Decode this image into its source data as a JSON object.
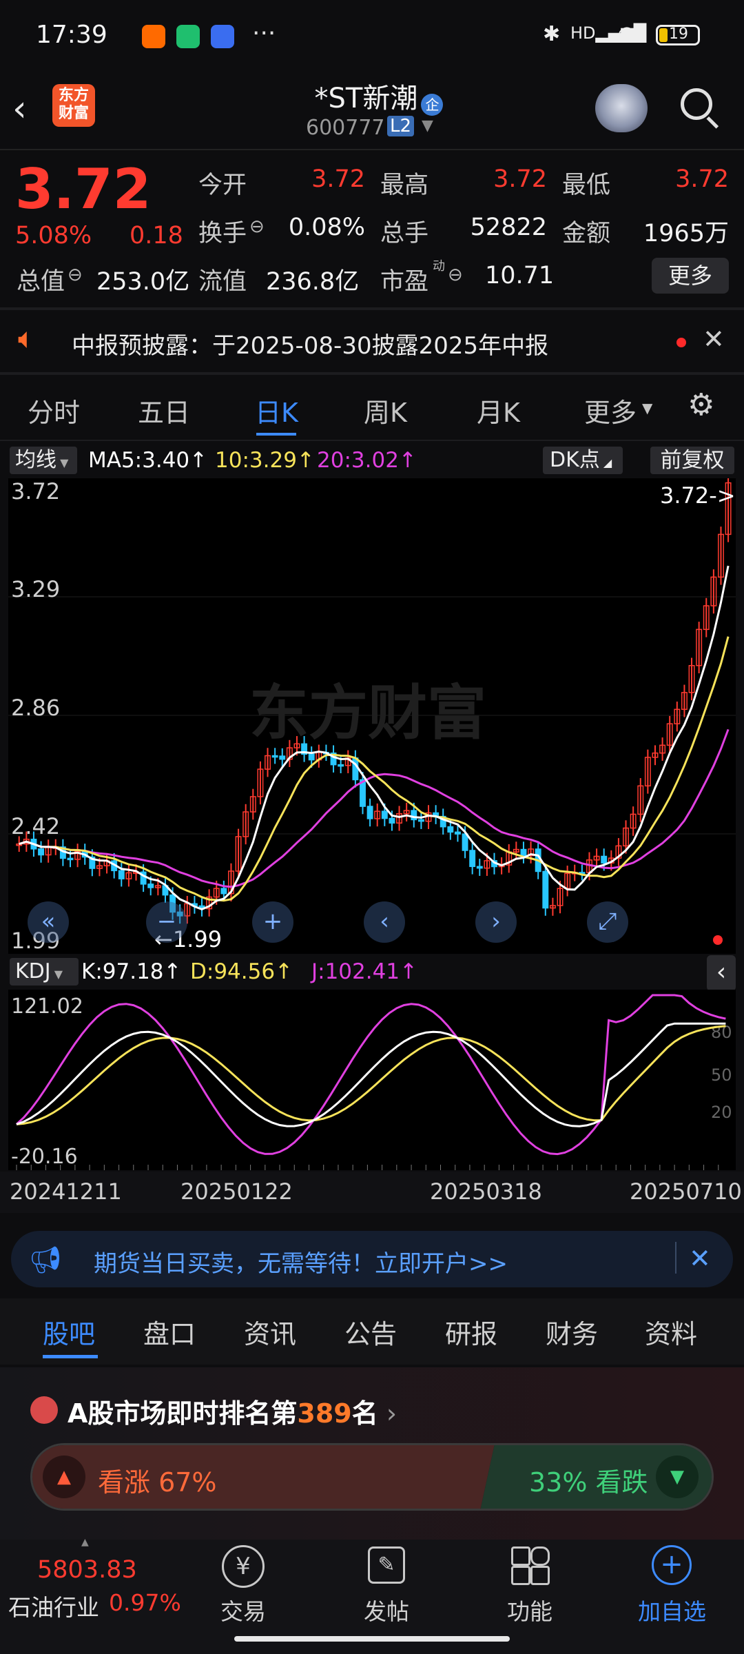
{
  "status_bar": {
    "time": "17:39",
    "dots": "···",
    "battery": "19"
  },
  "header": {
    "logo_line1": "东方",
    "logo_line2": "财富",
    "title": "*ST新潮",
    "title_badge": "企",
    "code": "600777",
    "level": "L2"
  },
  "quote": {
    "price": "3.72",
    "change_pct": "5.08%",
    "change_amt": "0.18",
    "rows": [
      [
        {
          "label": "今开",
          "value": "3.72",
          "color": "red"
        },
        {
          "label": "最高",
          "value": "3.72",
          "color": "red"
        },
        {
          "label": "最低",
          "value": "3.72",
          "color": "red"
        }
      ],
      [
        {
          "label": "换手",
          "value": "0.08%",
          "color": "white"
        },
        {
          "label": "总手",
          "value": "52822",
          "color": "white"
        },
        {
          "label": "金额",
          "value": "1965万",
          "color": "white"
        }
      ]
    ],
    "row3": {
      "total_label": "总值",
      "total_value": "253.0亿",
      "float_label": "流值",
      "float_value": "236.8亿",
      "pe_label": "市盈",
      "pe_sup": "动",
      "pe_value": "10.71"
    },
    "more_button": "更多"
  },
  "notice": {
    "text": "中报预披露：于2025-08-30披露2025年中报"
  },
  "k_tabs": [
    "分时",
    "五日",
    "日K",
    "周K",
    "月K",
    "更多"
  ],
  "ma_bar": {
    "selector": "均线",
    "ma5": "MA5:3.40",
    "ma10": "10:3.29",
    "ma20": "20:3.02",
    "dk": "DK点",
    "fq": "前复权"
  },
  "chart": {
    "price_labels": [
      "3.72",
      "3.29",
      "2.86",
      "2.42",
      "1.99"
    ],
    "last_label": "3.72->",
    "low_label": "1.99",
    "watermark": "东方财富"
  },
  "kdj": {
    "selector": "KDJ",
    "k": "K:97.18",
    "d": "D:94.56",
    "j": "J:102.41",
    "top": "121.02",
    "bottom": "-20.16",
    "levels": [
      "80",
      "50",
      "20"
    ]
  },
  "dates": [
    "20241211",
    "20250122",
    "20250318",
    "20250710"
  ],
  "ad": {
    "text": "期货当日买卖，无需等待！立即开户>>"
  },
  "bottom_tabs": [
    "股吧",
    "盘口",
    "资讯",
    "公告",
    "研报",
    "财务",
    "资料"
  ],
  "ranking": {
    "prefix": "A股市场即时排名第",
    "rank": "389",
    "suffix": "名"
  },
  "sentiment": {
    "up": "看涨 67%",
    "down": "33% 看跌",
    "up_fraction": 0.67
  },
  "bottom_nav": {
    "index_value": "5803.83",
    "industry": "石油行业",
    "industry_change": "0.97%",
    "items": [
      "交易",
      "发帖",
      "功能",
      "加自选"
    ]
  },
  "colors": {
    "up": "#ff3b30",
    "down": "#21c07a",
    "accent": "#3d8bff",
    "ma5": "#ffffff",
    "ma10": "#f7e35a",
    "ma20": "#e040e0"
  }
}
